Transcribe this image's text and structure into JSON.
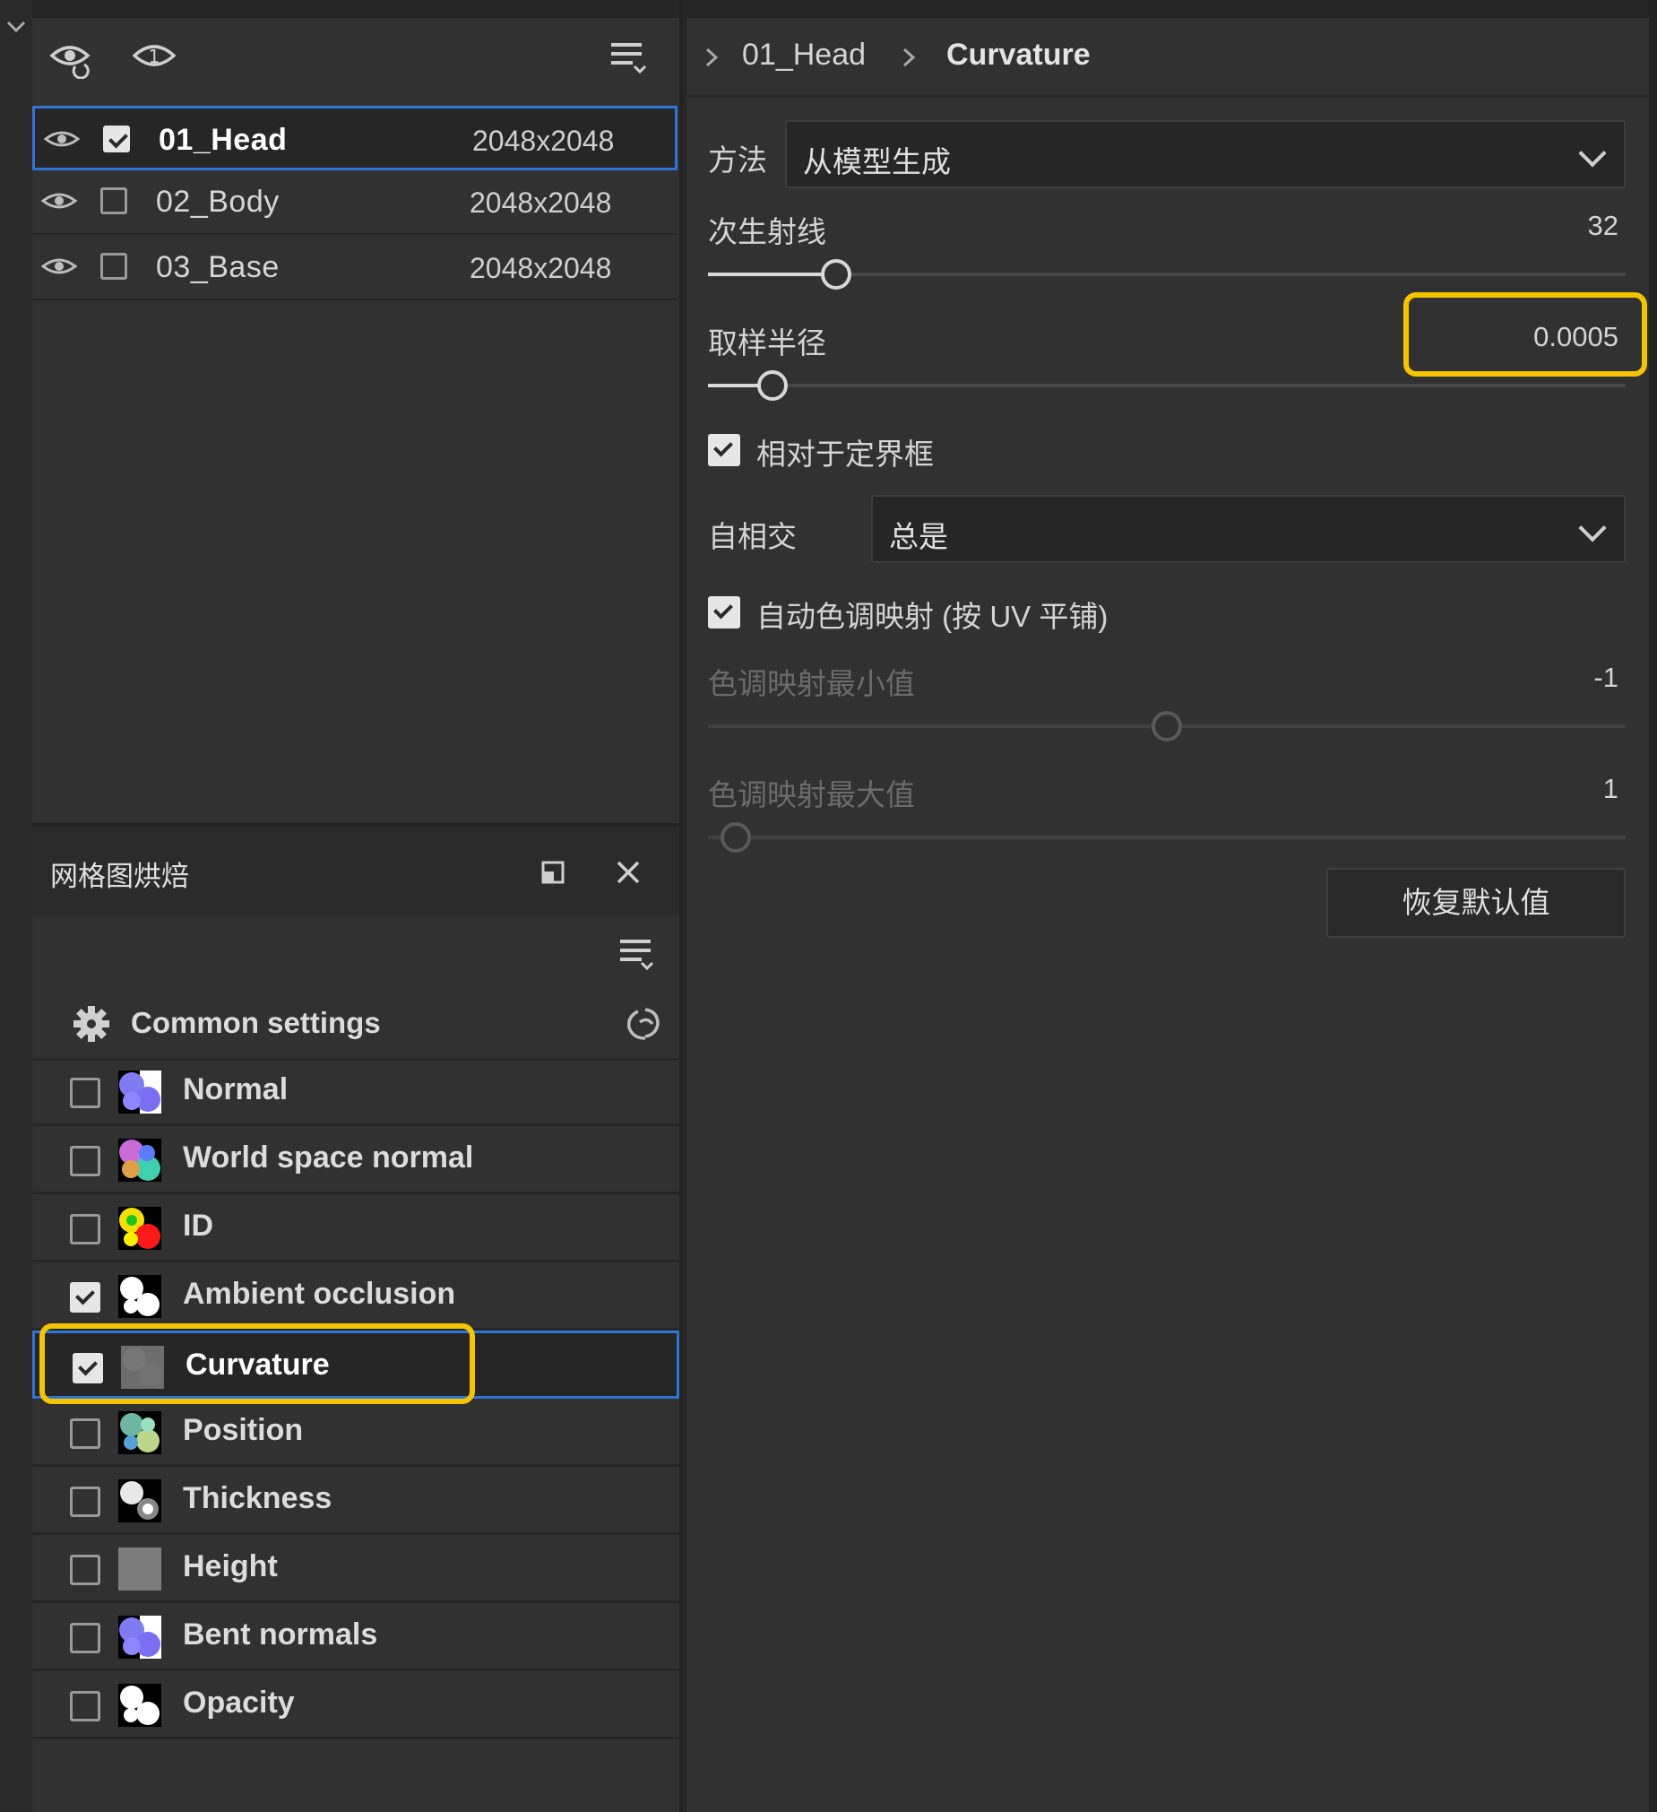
{
  "layers": [
    {
      "name": "01_Head",
      "resolution": "2048x2048",
      "checked": true,
      "selected": true
    },
    {
      "name": "02_Body",
      "resolution": "2048x2048",
      "checked": false,
      "selected": false
    },
    {
      "name": "03_Base",
      "resolution": "2048x2048",
      "checked": false,
      "selected": false
    }
  ],
  "bake_panel": {
    "title": "网格图烘焙",
    "common_settings_label": "Common settings",
    "maps": [
      {
        "label": "Normal",
        "checked": false,
        "icon": "normal-map-icon"
      },
      {
        "label": "World space normal",
        "checked": false,
        "icon": "world-space-normal-map-icon"
      },
      {
        "label": "ID",
        "checked": false,
        "icon": "id-map-icon"
      },
      {
        "label": "Ambient occlusion",
        "checked": true,
        "icon": "ambient-occlusion-map-icon"
      },
      {
        "label": "Curvature",
        "checked": true,
        "icon": "curvature-map-icon",
        "selected": true
      },
      {
        "label": "Position",
        "checked": false,
        "icon": "position-map-icon"
      },
      {
        "label": "Thickness",
        "checked": false,
        "icon": "thickness-map-icon"
      },
      {
        "label": "Height",
        "checked": false,
        "icon": "height-map-icon"
      },
      {
        "label": "Bent normals",
        "checked": false,
        "icon": "bent-normals-map-icon"
      },
      {
        "label": "Opacity",
        "checked": false,
        "icon": "opacity-map-icon"
      }
    ]
  },
  "breadcrumb": {
    "items": [
      "01_Head",
      "Curvature"
    ]
  },
  "settings": {
    "method": {
      "label": "方法",
      "value": "从模型生成"
    },
    "secondary_rays": {
      "label": "次生射线",
      "value": "32",
      "fraction": 0.14
    },
    "sampling_radius": {
      "label": "取样半径",
      "value": "0.0005",
      "fraction": 0.07
    },
    "relative_to_bbox": {
      "label": "相对于定界框",
      "checked": true
    },
    "self_intersect": {
      "label": "自相交",
      "value": "总是"
    },
    "auto_tonemap": {
      "label": "自动色调映射 (按 UV 平铺)",
      "checked": true
    },
    "tonemap_min": {
      "label": "色调映射最小值",
      "value": "-1",
      "fraction": 0.5
    },
    "tonemap_max": {
      "label": "色调映射最大值",
      "value": "1",
      "fraction": 0.03
    },
    "reset_label": "恢复默认值"
  },
  "colors": {
    "accent_blue": "#2f75d6",
    "highlight_yellow": "#f5c400",
    "panel_bg": "#313131"
  }
}
